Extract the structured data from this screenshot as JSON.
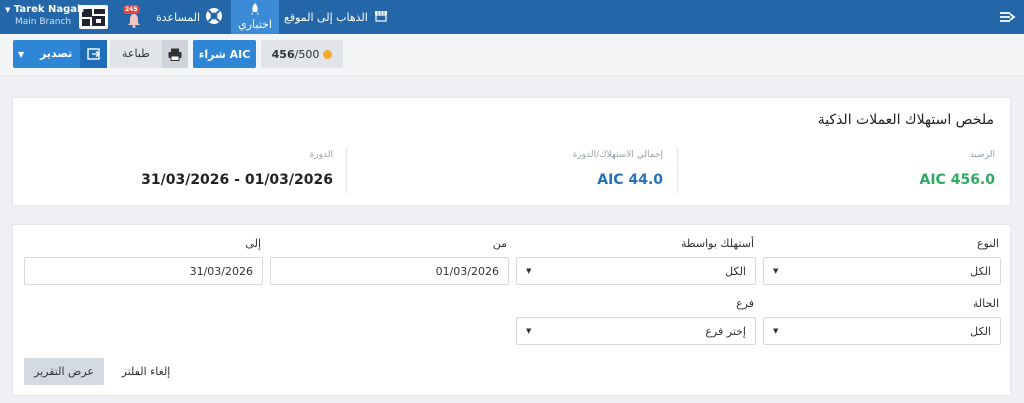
{
  "topbar": {
    "goto_site": "الذهاب إلى الموقع",
    "try": "اختباري",
    "help": "المساعدة",
    "notifications_count": "245",
    "user_name": "Tarek Nagah",
    "branch": "Main Branch"
  },
  "actions": {
    "export_label": "تصدير",
    "print_label": "طباعة",
    "buy_label": "شراء AIC",
    "credit_used": "456",
    "credit_total": "/500"
  },
  "summary": {
    "title": "ملخص استهلاك العملات الذكية",
    "balance_label": "الرصيد",
    "balance_value": "AIC 456.0",
    "consumption_label": "إجمالي الاستهلاك/الدورة",
    "consumption_value": "AIC 44.0",
    "period_label": "الدورة",
    "period_value": "31/03/2026 - 01/03/2026"
  },
  "filters": {
    "type_label": "النوع",
    "type_value": "الكل",
    "consumed_by_label": "أستهلك بواسطة",
    "consumed_by_value": "الكل",
    "from_label": "من",
    "from_value": "01/03/2026",
    "to_label": "إلى",
    "to_value": "31/03/2026",
    "status_label": "الحالة",
    "status_value": "الكل",
    "branch_label": "فرع",
    "branch_placeholder": "إختر فرع",
    "reset_label": "إلغاء الفلتر",
    "apply_label": "عرض التقرير"
  },
  "colors": {
    "topbar": "#2467a8",
    "primary": "#2f86d6",
    "balance": "#2daa60",
    "consumption": "#2572b8"
  },
  "icons": [
    "menu-icon",
    "store-icon",
    "rocket-icon",
    "lifebuoy-icon",
    "bell-icon",
    "logo",
    "printer-icon",
    "export-icon",
    "coin-icon",
    "chevron-down-icon"
  ]
}
